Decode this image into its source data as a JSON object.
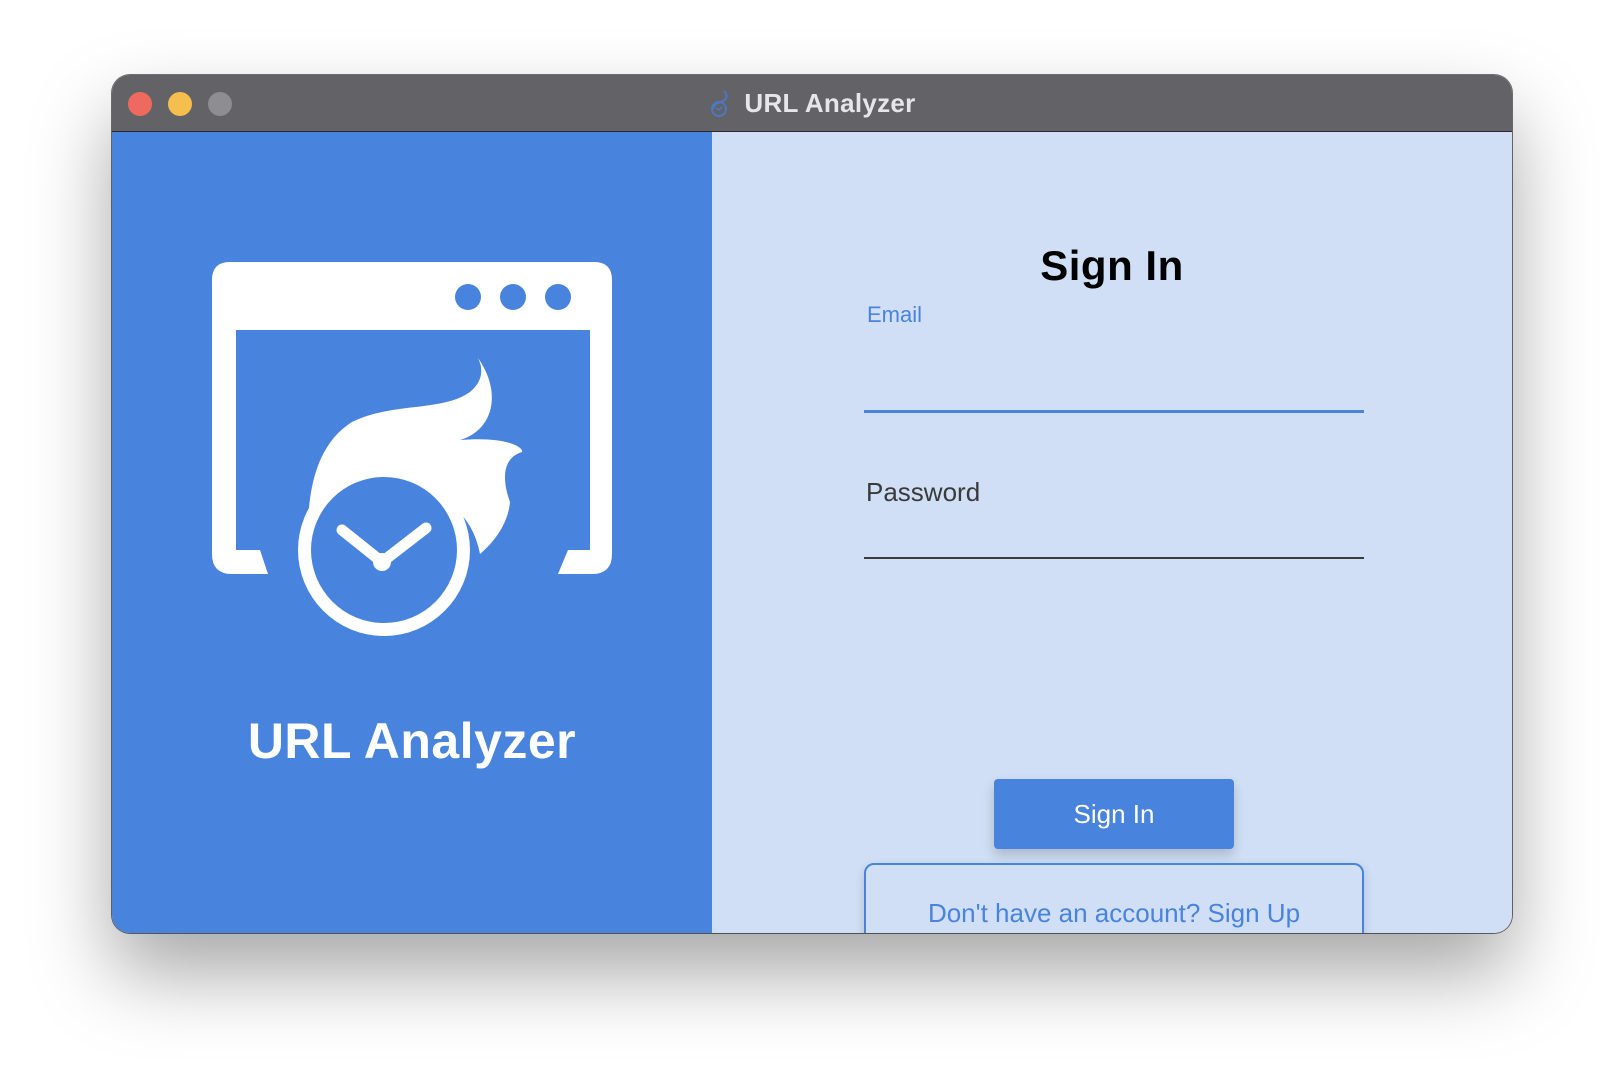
{
  "window": {
    "title": "URL Analyzer",
    "title_icon": "flame-clock-icon",
    "controls": [
      "close",
      "minimize",
      "maximize"
    ]
  },
  "left_panel": {
    "logo_icon": "browser-window-flame-clock-icon",
    "app_name": "URL Analyzer"
  },
  "sign_in_form": {
    "heading": "Sign In",
    "email": {
      "label": "Email",
      "value": ""
    },
    "password": {
      "label": "Password",
      "value": ""
    },
    "submit_label": "Sign In",
    "signup_label": "Don't have an account? Sign Up"
  },
  "colors": {
    "accent": "#4883dd",
    "panel_light": "#d0dff6",
    "titlebar": "#636267"
  }
}
